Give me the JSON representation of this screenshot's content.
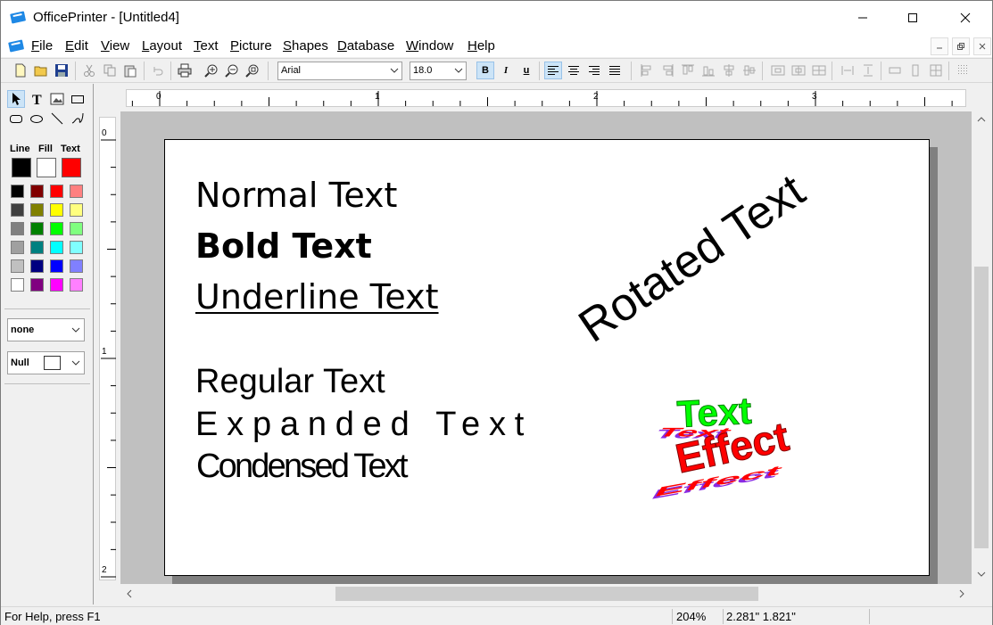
{
  "window": {
    "title": "OfficePrinter - [Untitled4]"
  },
  "menu": [
    {
      "label": "File",
      "ul": "F",
      "rest": "ile"
    },
    {
      "label": "Edit",
      "ul": "E",
      "rest": "dit"
    },
    {
      "label": "View",
      "ul": "V",
      "rest": "iew"
    },
    {
      "label": "Layout",
      "ul": "L",
      "rest": "ayout"
    },
    {
      "label": "Text",
      "ul": "T",
      "rest": "ext"
    },
    {
      "label": "Picture",
      "ul": "P",
      "rest": "icture"
    },
    {
      "label": "Shapes",
      "ul": "S",
      "rest": "hapes"
    },
    {
      "label": "Database",
      "ul": "D",
      "rest": "atabase"
    },
    {
      "label": "Window",
      "ul": "W",
      "rest": "indow"
    },
    {
      "label": "Help",
      "ul": "H",
      "rest": "elp"
    }
  ],
  "toolbar": {
    "font_name": "Arial",
    "font_size": "18.0",
    "bold_label": "B",
    "italic_label": "I",
    "underline_label": "u"
  },
  "palette": {
    "line_label": "Line",
    "fill_label": "Fill",
    "text_label": "Text",
    "current_line": "#000000",
    "current_fill": "#ffffff",
    "current_text": "#ff0000",
    "colors": [
      [
        "#000000",
        "#800000",
        "#ff0000",
        "#ff8080"
      ],
      [
        "#404040",
        "#808000",
        "#ffff00",
        "#ffff80"
      ],
      [
        "#808080",
        "#008000",
        "#00ff00",
        "#80ff80"
      ],
      [
        "#a0a0a0",
        "#008080",
        "#00ffff",
        "#80ffff"
      ],
      [
        "#c0c0c0",
        "#000080",
        "#0000ff",
        "#8080ff"
      ],
      [
        "#ffffff",
        "#800080",
        "#ff00ff",
        "#ff80ff"
      ]
    ],
    "line_style": "none",
    "fill_style": "Null"
  },
  "rulers": {
    "h_labels": [
      "0",
      "1",
      "2",
      "3"
    ],
    "v_labels": [
      "0",
      "1",
      "2"
    ]
  },
  "document": {
    "normal": "Normal Text",
    "bold": "Bold Text",
    "underline": "Underline Text",
    "regular": "Regular Text",
    "expanded": "Expanded Text",
    "condensed": "Condensed Text",
    "rotated": "Rotated Text",
    "effect_word1": "Text",
    "effect_word2": "Effect"
  },
  "status": {
    "help": "For Help, press F1",
    "zoom": "204%",
    "coords": "2.281\" 1.821\""
  }
}
